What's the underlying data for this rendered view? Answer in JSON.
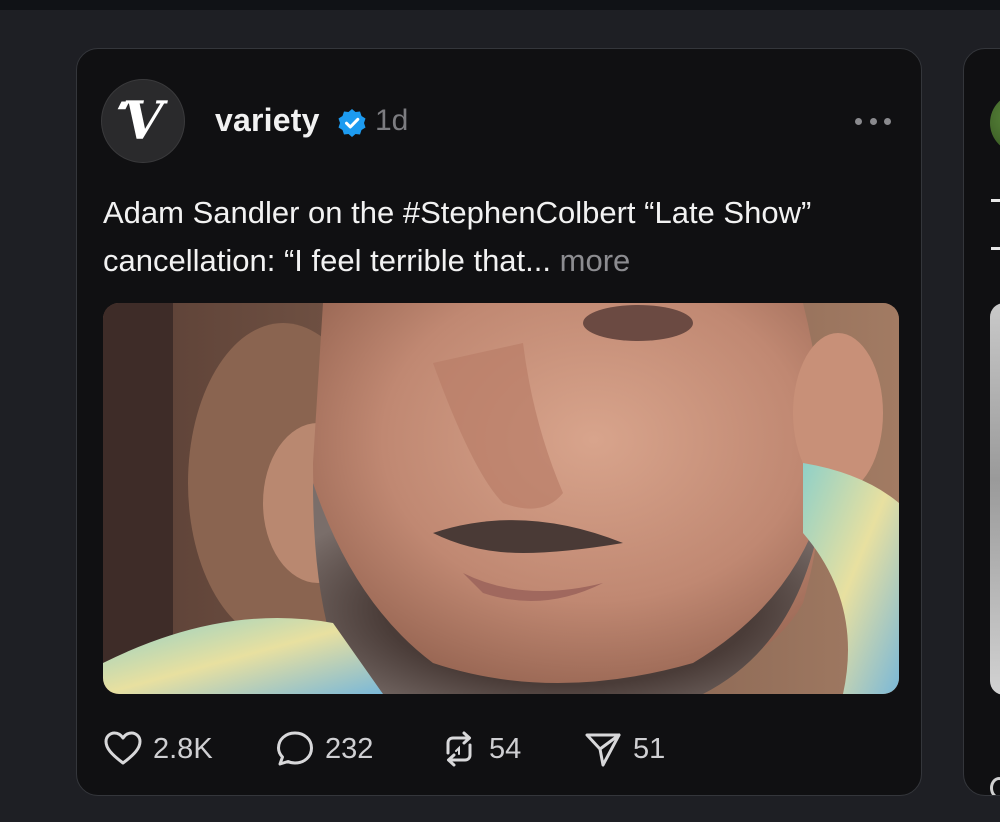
{
  "post": {
    "author": "variety",
    "avatar_letter": "V",
    "verified": true,
    "timestamp": "1d",
    "text": "Adam Sandler on the #StephenColbert “Late Show” cancellation: “I feel terrible that...",
    "more_label": "more",
    "media": {
      "type": "video-still",
      "description_icon": "image"
    },
    "actions": {
      "likes": "2.8K",
      "replies": "232",
      "reposts": "54",
      "shares": "51"
    }
  },
  "icons": {
    "like": "heart-icon",
    "reply": "speech-bubble-icon",
    "repost": "repost-arrows-icon",
    "share": "send-paper-plane-icon",
    "verified": "verified-badge-icon",
    "more": "ellipsis-icon"
  },
  "colors": {
    "background": "#1e1f24",
    "card": "#101012",
    "verified_blue": "#1d9bf0",
    "muted_text": "#7c7c80"
  }
}
